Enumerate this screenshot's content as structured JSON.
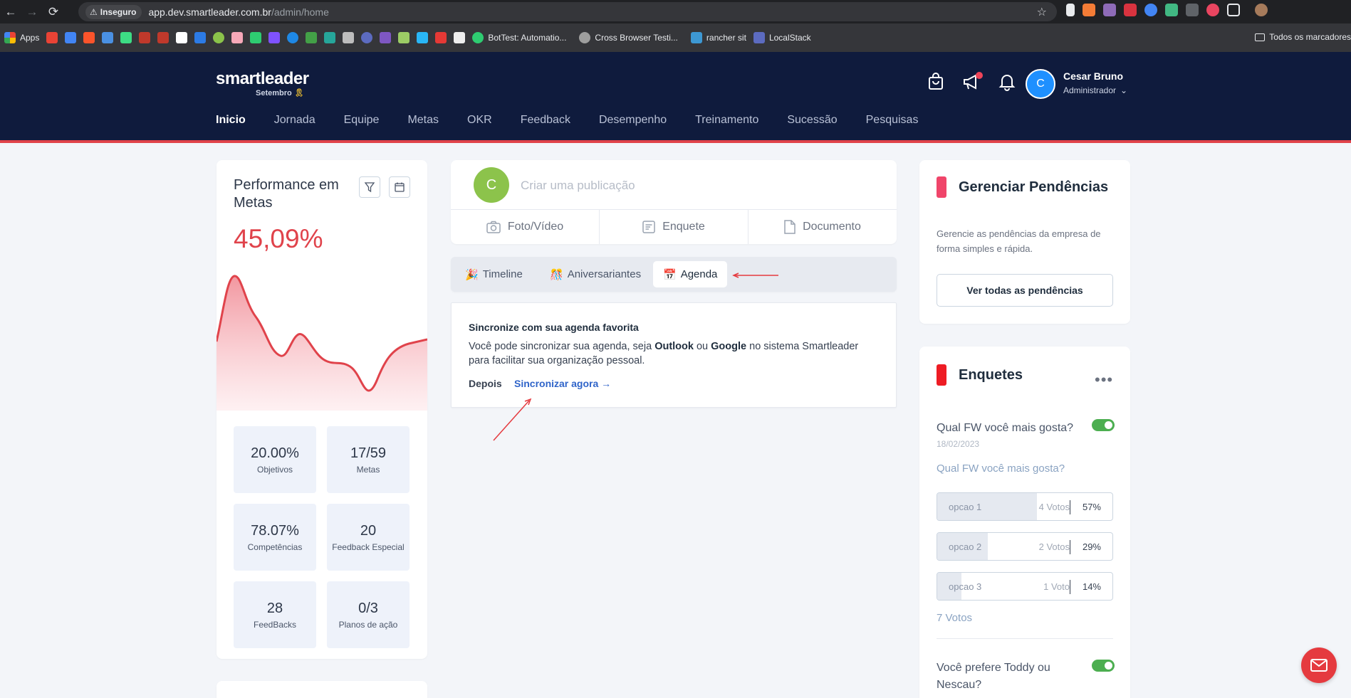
{
  "browser": {
    "security_label": "Inseguro",
    "url_host": "app.dev.smartleader.com.br",
    "url_path": "/admin/home",
    "bookmarks": {
      "apps": "Apps",
      "bottest": "BotTest: Automatio...",
      "crossbrowser": "Cross Browser Testi...",
      "rancher": "rancher sit",
      "localstack": "LocalStack",
      "all_bookmarks": "Todos os marcadores"
    }
  },
  "header": {
    "logo_word": "smartleader",
    "logo_month": "Setembro",
    "nav": [
      "Inicio",
      "Jornada",
      "Equipe",
      "Metas",
      "OKR",
      "Feedback",
      "Desempenho",
      "Treinamento",
      "Sucessão",
      "Pesquisas"
    ],
    "user": {
      "initial": "C",
      "name": "Cesar Bruno",
      "role": "Administrador"
    }
  },
  "performance": {
    "title": "Performance em Metas",
    "value": "45,09%",
    "stats": [
      {
        "value": "20.00%",
        "label": "Objetivos"
      },
      {
        "value": "17/59",
        "label": "Metas"
      },
      {
        "value": "78.07%",
        "label": "Competências"
      },
      {
        "value": "20",
        "label": "Feedback Especial"
      },
      {
        "value": "28",
        "label": "FeedBacks"
      },
      {
        "value": "0/3",
        "label": "Planos de ação"
      }
    ]
  },
  "post": {
    "initial": "C",
    "placeholder": "Criar uma publicação",
    "actions": [
      "Foto/Vídeo",
      "Enquete",
      "Documento"
    ]
  },
  "tabs": {
    "timeline": "Timeline",
    "birthdays": "Aniversariantes",
    "agenda": "Agenda"
  },
  "agenda": {
    "title": "Sincronize com sua agenda favorita",
    "text_1": "Você pode sincronizar sua agenda, seja ",
    "outlook": "Outlook",
    "text_2": " ou ",
    "google": "Google",
    "text_3": " no sistema Smartleader para facilitar sua organização pessoal.",
    "later": "Depois",
    "sync": "Sincronizar agora →"
  },
  "pendencias": {
    "title": "Gerenciar Pendências",
    "text": "Gerencie as pendências da empresa de forma simples e rápida.",
    "button": "Ver todas as pendências",
    "accent": "#f0456a"
  },
  "enquetes": {
    "title": "Enquetes",
    "more": "•••",
    "accent": "#ee1c24",
    "poll1": {
      "question": "Qual FW você mais gosta?",
      "date": "18/02/2023",
      "subtitle": "Qual FW você mais gosta?",
      "options": [
        {
          "label": "opcao 1",
          "votes": "4 Votos",
          "pct": "57%",
          "fraction": 0.57
        },
        {
          "label": "opcao 2",
          "votes": "2 Votos",
          "pct": "29%",
          "fraction": 0.29
        },
        {
          "label": "opcao 3",
          "votes": "1 Voto",
          "pct": "14%",
          "fraction": 0.14
        }
      ],
      "total": "7 Votos"
    },
    "poll2": {
      "question": "Você prefere Toddy ou Nescau?"
    }
  },
  "colors": {
    "header_bg": "#0f1b3d",
    "brand_red": "#e0434b",
    "link_blue": "#2f64c9"
  }
}
